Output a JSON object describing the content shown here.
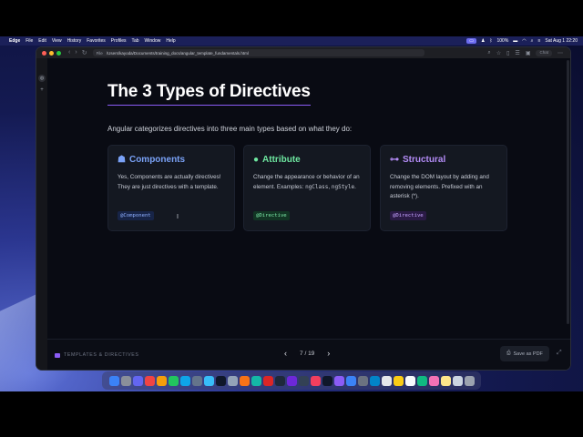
{
  "menubar": {
    "app": "Edge",
    "items": [
      "File",
      "Edit",
      "View",
      "History",
      "Favorites",
      "Profiles",
      "Tab",
      "Window",
      "Help"
    ],
    "battery": "100%",
    "clock": "Sat Aug 1  22:20"
  },
  "browser": {
    "url_scheme": "File",
    "url": "/Users/kayoda/Documents/training_docs/angular_template_fundamentals.html",
    "chat_label": "Chat"
  },
  "slide": {
    "title": "The 3 Types of Directives",
    "intro": "Angular categorizes directives into three main types based on what they do:",
    "cards": [
      {
        "icon": "component-icon",
        "heading": "Components",
        "desc": "Yes, Components are actually directives! They are just directives with a template.",
        "tag": "@Component",
        "accent": "#7aa2f7"
      },
      {
        "icon": "palette-icon",
        "heading": "Attribute",
        "desc_pre": "Change the appearance or behavior of an element. Examples: ",
        "code1": "ngClass",
        "sep": ", ",
        "code2": "ngStyle",
        "desc_post": ".",
        "tag": "@Directive",
        "accent": "#6ee7a0"
      },
      {
        "icon": "structure-icon",
        "heading": "Structural",
        "desc": "Change the DOM layout by adding and removing elements. Prefixed with an asterisk (*).",
        "tag": "@Directive",
        "accent": "#b48cf7"
      }
    ]
  },
  "footer": {
    "brand": "TEMPLATES & DIRECTIVES",
    "page_current": "7",
    "page_sep": "/",
    "page_total": "19",
    "save_pdf": "Save as PDF"
  }
}
